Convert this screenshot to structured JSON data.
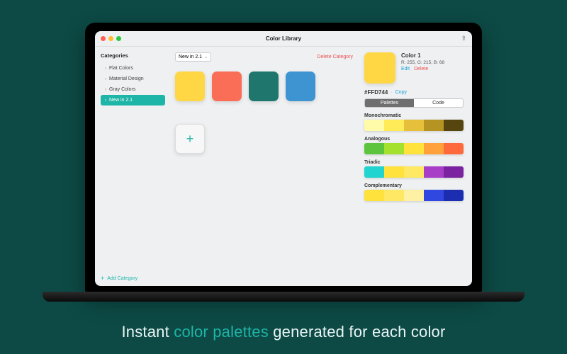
{
  "window": {
    "title": "Color Library",
    "share_icon": "⇧"
  },
  "sidebar": {
    "heading": "Categories",
    "items": [
      {
        "label": "Flat Colors",
        "active": false
      },
      {
        "label": "Material Design",
        "active": false
      },
      {
        "label": "Gray Colors",
        "active": false
      },
      {
        "label": "New in 2.1",
        "active": true
      }
    ],
    "add_label": "Add Category"
  },
  "main": {
    "dropdown_label": "New in 2.1",
    "delete_category": "Delete Category",
    "swatches": [
      "#ffd744",
      "#fa6e58",
      "#1f766d",
      "#3e94d1"
    ]
  },
  "detail": {
    "swatch": "#ffd744",
    "name": "Color 1",
    "rgb": "R: 255, G: 215, B: 68",
    "edit": "Edit",
    "delete": "Delete",
    "hex": "#FFD744",
    "copy": "Copy",
    "segments": {
      "palettes": "Palettes",
      "code": "Code"
    },
    "palettes": [
      {
        "label": "Monochromatic",
        "colors": [
          "#fffba8",
          "#ffeb57",
          "#e6c03a",
          "#b69423",
          "#574510"
        ]
      },
      {
        "label": "Analogous",
        "colors": [
          "#5cc43d",
          "#a4e02e",
          "#ffe23c",
          "#ffa23c",
          "#ff6a3c"
        ]
      },
      {
        "label": "Triadic",
        "colors": [
          "#22d4cf",
          "#ffe23c",
          "#ffe964",
          "#a83dc8",
          "#7a22a0"
        ]
      },
      {
        "label": "Complementary",
        "colors": [
          "#ffe23c",
          "#ffe964",
          "#fff1a4",
          "#3047e0",
          "#1c2db0"
        ]
      }
    ]
  },
  "caption": {
    "before": "Instant ",
    "highlight": "color palettes",
    "after": " generated for each color"
  }
}
